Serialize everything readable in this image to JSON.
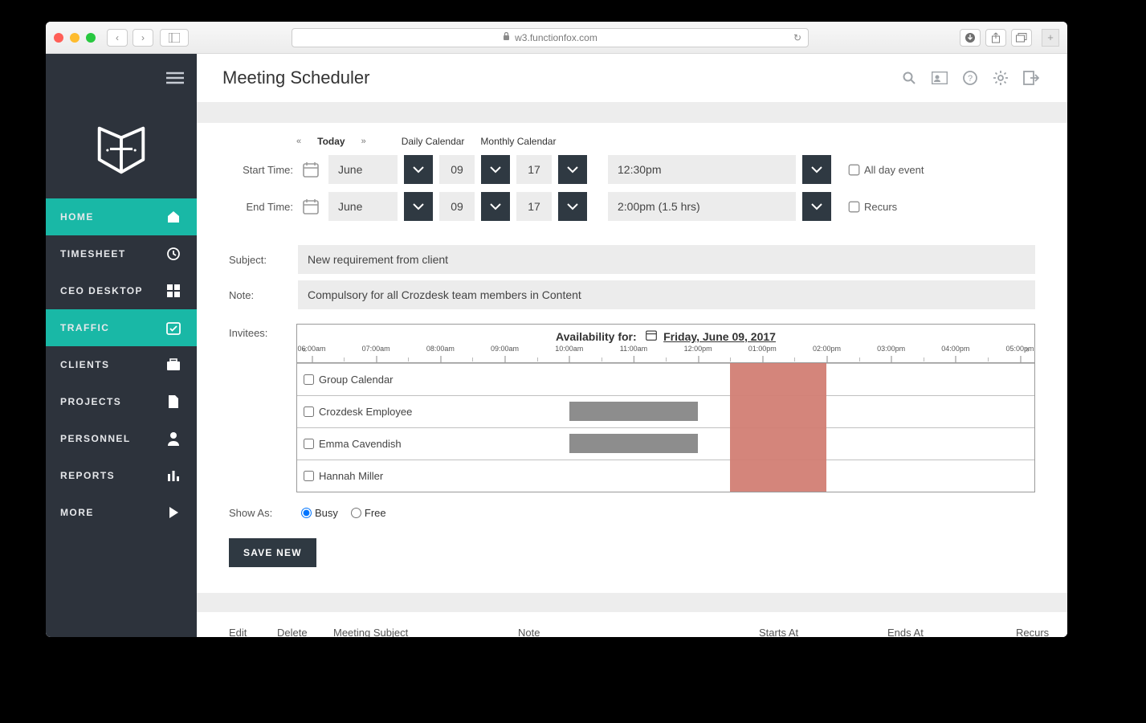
{
  "browser": {
    "url": "w3.functionfox.com"
  },
  "sidebar": {
    "items": [
      {
        "label": "HOME",
        "icon": "home",
        "active": true
      },
      {
        "label": "TIMESHEET",
        "icon": "clock",
        "active": false
      },
      {
        "label": "CEO DESKTOP",
        "icon": "grid",
        "active": false
      },
      {
        "label": "TRAFFIC",
        "icon": "calendar-check",
        "active": true
      },
      {
        "label": "CLIENTS",
        "icon": "briefcase",
        "active": false
      },
      {
        "label": "PROJECTS",
        "icon": "file",
        "active": false
      },
      {
        "label": "PERSONNEL",
        "icon": "person",
        "active": false
      },
      {
        "label": "REPORTS",
        "icon": "bar",
        "active": false
      },
      {
        "label": "MORE",
        "icon": "play",
        "active": false
      }
    ]
  },
  "header": {
    "title": "Meeting Scheduler"
  },
  "calendarNav": {
    "prev": "«",
    "today": "Today",
    "next": "»",
    "daily": "Daily Calendar",
    "monthly": "Monthly Calendar"
  },
  "start": {
    "label": "Start Time:",
    "month": "June",
    "day": "09",
    "year": "17",
    "time": "12:30pm",
    "allDayLabel": "All day event",
    "allDayChecked": false
  },
  "end": {
    "label": "End Time:",
    "month": "June",
    "day": "09",
    "year": "17",
    "time": "2:00pm (1.5 hrs)",
    "recursLabel": "Recurs",
    "recursChecked": false
  },
  "subject": {
    "label": "Subject:",
    "value": "New requirement from client"
  },
  "note": {
    "label": "Note:",
    "value": "Compulsory for all Crozdesk team members in Content"
  },
  "invitees": {
    "label": "Invitees:",
    "title": "Availability for:",
    "date": "Friday, June 09, 2017",
    "hours": [
      "06:00am",
      "07:00am",
      "08:00am",
      "09:00am",
      "10:00am",
      "11:00am",
      "12:00pm",
      "01:00pm",
      "02:00pm",
      "03:00pm",
      "04:00pm",
      "05:00pm"
    ],
    "rows": [
      {
        "name": "Group Calendar",
        "busy": []
      },
      {
        "name": "Crozdesk Employee",
        "busy": [
          {
            "from": "10:00am",
            "to": "12:00pm"
          }
        ]
      },
      {
        "name": "Emma Cavendish",
        "busy": [
          {
            "from": "10:00am",
            "to": "12:00pm"
          }
        ]
      },
      {
        "name": "Hannah Miller",
        "busy": []
      }
    ],
    "meeting": {
      "from": "12:30pm",
      "to": "02:00pm"
    }
  },
  "showAs": {
    "label": "Show As:",
    "busy": "Busy",
    "free": "Free",
    "selected": "busy"
  },
  "saveLabel": "SAVE NEW",
  "listHead": {
    "edit": "Edit",
    "delete": "Delete",
    "subject": "Meeting Subject",
    "note": "Note",
    "starts": "Starts At",
    "ends": "Ends At",
    "recurs": "Recurs"
  }
}
